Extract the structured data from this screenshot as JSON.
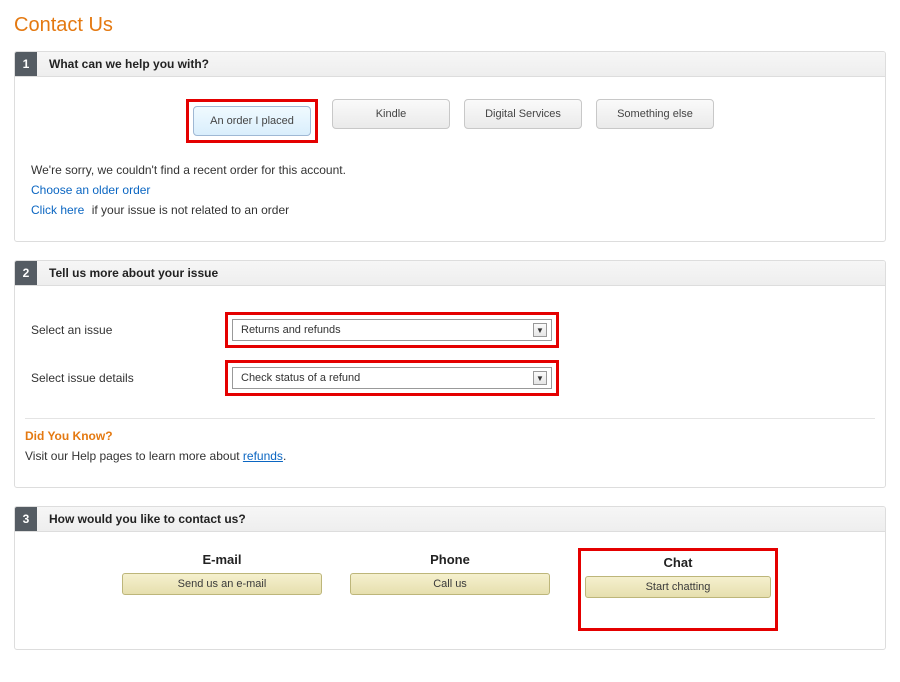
{
  "page": {
    "title": "Contact Us"
  },
  "step1": {
    "number": "1",
    "title": "What can we help you with?",
    "tabs": {
      "order": "An order I placed",
      "kindle": "Kindle",
      "digital": "Digital Services",
      "other": "Something else"
    },
    "no_order_msg": "We're sorry, we couldn't find a recent order for this account.",
    "choose_older": "Choose an older order",
    "click_here": "Click here",
    "click_here_suffix": " if your issue is not related to an order"
  },
  "step2": {
    "number": "2",
    "title": "Tell us more about your issue",
    "issue_label": "Select an issue",
    "issue_value": "Returns and refunds",
    "details_label": "Select issue details",
    "details_value": "Check status of a refund",
    "dyk_title": "Did You Know?",
    "dyk_text": "Visit our Help pages to learn more about ",
    "dyk_link": "refunds"
  },
  "step3": {
    "number": "3",
    "title": "How would you like to contact us?",
    "email": {
      "head": "E-mail",
      "btn": "Send us an e-mail"
    },
    "phone": {
      "head": "Phone",
      "btn": "Call us"
    },
    "chat": {
      "head": "Chat",
      "btn": "Start chatting"
    }
  }
}
